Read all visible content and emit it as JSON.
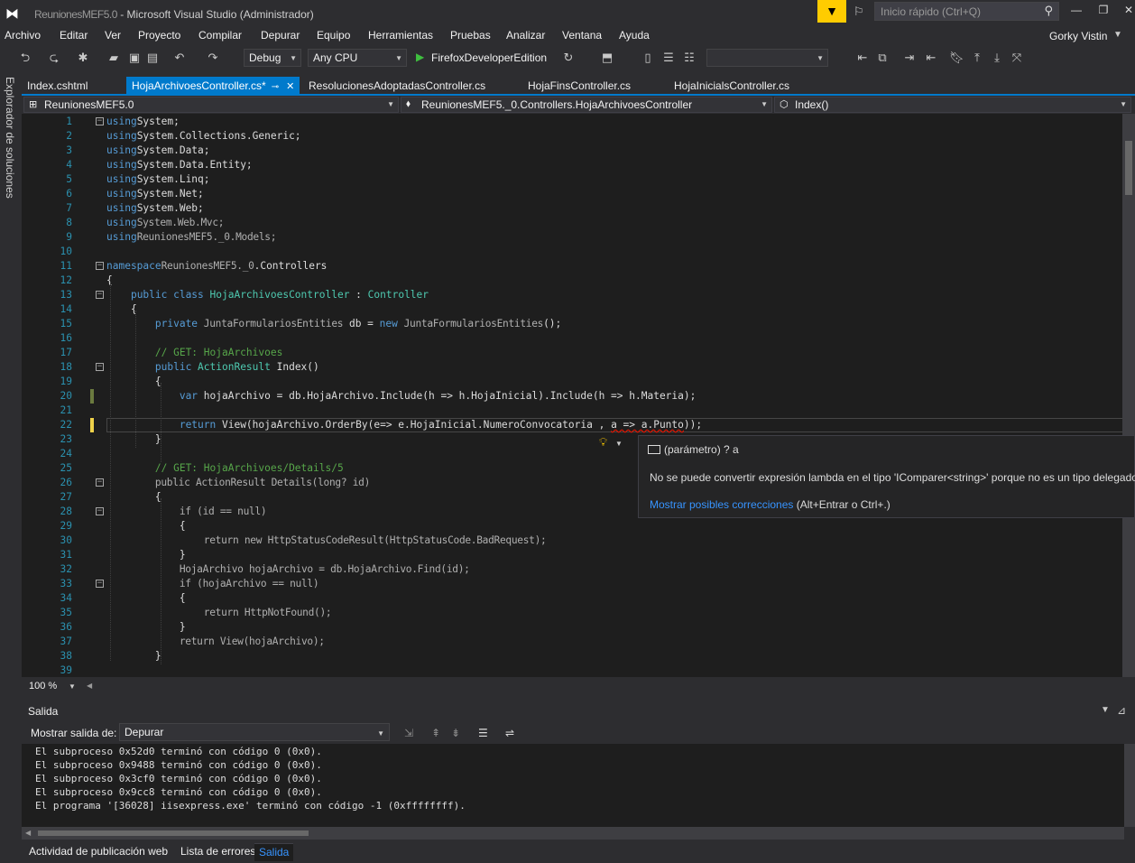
{
  "window": {
    "logo": "VS",
    "title_blurred": "ReunionesMEF5.0",
    "title": " - Microsoft Visual Studio (Administrador)",
    "quick_launch_placeholder": "Inicio rápido (Ctrl+Q)",
    "account": "Gorky Vistin"
  },
  "menu": [
    "Archivo",
    "Editar",
    "Ver",
    "Proyecto",
    "Compilar",
    "Depurar",
    "Equipo",
    "Herramientas",
    "Pruebas",
    "Analizar",
    "Ventana",
    "Ayuda"
  ],
  "toolbar": {
    "config": "Debug",
    "platform": "Any CPU",
    "run_target": "FirefoxDeveloperEdition"
  },
  "sidestrip": {
    "label": "Explorador de soluciones"
  },
  "tabs": [
    {
      "label": "Index.cshtml",
      "active": false
    },
    {
      "label": "HojaArchivoesController.cs*",
      "active": true
    },
    {
      "label": "ResolucionesAdoptadasController.cs",
      "active": false
    },
    {
      "label": "HojaFinsController.cs",
      "active": false
    },
    {
      "label": "HojaInicialsController.cs",
      "active": false
    }
  ],
  "navbar": {
    "project": "ReunionesMEF5.0",
    "type": "ReunionesMEF5._0.Controllers.HojaArchivoesController",
    "member": "Index()"
  },
  "code_lines": [
    {
      "n": "1",
      "tokens": [
        [
          "kw",
          "using"
        ],
        [
          "",
          "System;"
        ]
      ]
    },
    {
      "n": "2",
      "tokens": [
        [
          "kw",
          "using"
        ],
        [
          "",
          "System.Collections.Generic;"
        ]
      ]
    },
    {
      "n": "3",
      "tokens": [
        [
          "kw",
          "using"
        ],
        [
          "",
          "System.Data;"
        ]
      ]
    },
    {
      "n": "4",
      "tokens": [
        [
          "kw",
          "using"
        ],
        [
          "",
          "System.Data.Entity;"
        ]
      ]
    },
    {
      "n": "5",
      "tokens": [
        [
          "kw",
          "using"
        ],
        [
          "",
          "System.Linq;"
        ]
      ]
    },
    {
      "n": "6",
      "tokens": [
        [
          "kw",
          "using"
        ],
        [
          "",
          "System.Net;"
        ]
      ]
    },
    {
      "n": "7",
      "tokens": [
        [
          "kw",
          "using"
        ],
        [
          "",
          "System.Web;"
        ]
      ]
    },
    {
      "n": "8",
      "tokens": [
        [
          "kw",
          "using"
        ],
        [
          "blur",
          "System.Web.Mvc;"
        ]
      ]
    },
    {
      "n": "9",
      "tokens": [
        [
          "kw",
          "using"
        ],
        [
          "blur",
          "ReunionesMEF5._0.Models;"
        ]
      ]
    },
    {
      "n": "10",
      "tokens": []
    },
    {
      "n": "11",
      "tokens": [
        [
          "kw",
          "namespace"
        ],
        [
          "blur",
          "ReunionesMEF5._0"
        ],
        [
          "",
          ".Controllers"
        ]
      ]
    },
    {
      "n": "12",
      "tokens": [
        [
          "",
          "{"
        ]
      ]
    },
    {
      "n": "13",
      "tokens": [
        [
          "",
          "    "
        ],
        [
          "kw",
          "public class "
        ],
        [
          "ty",
          "HojaArchivoesController"
        ],
        [
          "",
          " : "
        ],
        [
          "ty",
          "Controller"
        ]
      ]
    },
    {
      "n": "14",
      "tokens": [
        [
          "",
          "    {"
        ]
      ]
    },
    {
      "n": "15",
      "tokens": [
        [
          "",
          "        "
        ],
        [
          "kw",
          "private "
        ],
        [
          "blur",
          "JuntaFormulariosEntities"
        ],
        [
          "",
          " db = "
        ],
        [
          "kw",
          "new "
        ],
        [
          "blur",
          "JuntaFormulariosEntities"
        ],
        [
          "",
          "();"
        ]
      ]
    },
    {
      "n": "16",
      "tokens": []
    },
    {
      "n": "17",
      "tokens": [
        [
          "",
          "        "
        ],
        [
          "cm",
          "// GET: HojaArchivoes"
        ]
      ]
    },
    {
      "n": "18",
      "tokens": [
        [
          "",
          "        "
        ],
        [
          "kw",
          "public "
        ],
        [
          "ty",
          "ActionResult"
        ],
        [
          "",
          " Index()"
        ]
      ]
    },
    {
      "n": "19",
      "tokens": [
        [
          "",
          "        {"
        ]
      ]
    },
    {
      "n": "20",
      "tokens": [
        [
          "",
          "            "
        ],
        [
          "kw",
          "var "
        ],
        [
          "",
          "hojaArchivo = db.HojaArchivo.Include(h => h.HojaInicial).Include(h => h.Materia);"
        ]
      ]
    },
    {
      "n": "21",
      "tokens": []
    },
    {
      "n": "22",
      "tokens": [
        [
          "",
          "            "
        ],
        [
          "kw",
          "return "
        ],
        [
          "",
          "View(hojaArchivo.OrderBy(e=> e.HojaInicial.NumeroConvocatoria , "
        ],
        [
          "squiggle",
          "a => a.Punto"
        ],
        [
          "",
          "));"
        ]
      ]
    },
    {
      "n": "23",
      "tokens": [
        [
          "",
          "        }"
        ]
      ]
    },
    {
      "n": "24",
      "tokens": []
    },
    {
      "n": "25",
      "tokens": [
        [
          "",
          "        "
        ],
        [
          "cm",
          "// GET: HojaArchivoes/Details/5"
        ]
      ]
    },
    {
      "n": "26",
      "tokens": [
        [
          "",
          "        "
        ],
        [
          "blur",
          "public ActionResult Details(long? id)"
        ]
      ]
    },
    {
      "n": "27",
      "tokens": [
        [
          "",
          "        {"
        ]
      ]
    },
    {
      "n": "28",
      "tokens": [
        [
          "",
          "            "
        ],
        [
          "blur",
          "if (id == null)"
        ]
      ]
    },
    {
      "n": "29",
      "tokens": [
        [
          "",
          "            {"
        ]
      ]
    },
    {
      "n": "30",
      "tokens": [
        [
          "",
          "                "
        ],
        [
          "blur",
          "return new HttpStatusCodeResult(HttpStatusCode.BadRequest);"
        ]
      ]
    },
    {
      "n": "31",
      "tokens": [
        [
          "",
          "            }"
        ]
      ]
    },
    {
      "n": "32",
      "tokens": [
        [
          "",
          "            "
        ],
        [
          "blur",
          "HojaArchivo hojaArchivo = db.HojaArchivo.Find(id);"
        ]
      ]
    },
    {
      "n": "33",
      "tokens": [
        [
          "",
          "            "
        ],
        [
          "blur",
          "if (hojaArchivo == null)"
        ]
      ]
    },
    {
      "n": "34",
      "tokens": [
        [
          "",
          "            {"
        ]
      ]
    },
    {
      "n": "35",
      "tokens": [
        [
          "",
          "                "
        ],
        [
          "blur",
          "return HttpNotFound();"
        ]
      ]
    },
    {
      "n": "36",
      "tokens": [
        [
          "",
          "            }"
        ]
      ]
    },
    {
      "n": "37",
      "tokens": [
        [
          "",
          "            "
        ],
        [
          "blur",
          "return View(hojaArchivo);"
        ]
      ]
    },
    {
      "n": "38",
      "tokens": [
        [
          "",
          "        }"
        ]
      ]
    },
    {
      "n": "39",
      "tokens": []
    }
  ],
  "tooltip": {
    "signature": "(parámetro) ? a",
    "message": "No se puede convertir expresión lambda en el tipo 'IComparer<string>' porque no es un tipo delegado",
    "link": "Mostrar posibles correcciones",
    "shortcut": " (Alt+Entrar o Ctrl+.)"
  },
  "zoom": "100 %",
  "output": {
    "title": "Salida",
    "show_label": "Mostrar salida de:",
    "source": "Depurar",
    "lines": [
      "El subproceso 0x52d0 terminó con código 0 (0x0).",
      "El subproceso 0x9488 terminó con código 0 (0x0).",
      "El subproceso 0x3cf0 terminó con código 0 (0x0).",
      "El subproceso 0x9cc8 terminó con código 0 (0x0).",
      "El programa '[36028] iisexpress.exe' terminó con código -1 (0xffffffff)."
    ]
  },
  "bottom_tabs": [
    {
      "label": "Actividad de publicación web",
      "active": false
    },
    {
      "label": "Lista de errores",
      "active": false
    },
    {
      "label": "Salida",
      "active": true
    }
  ],
  "colors": {
    "accent": "#007acc",
    "notification": "#ffcc00",
    "error": "#e51400"
  }
}
